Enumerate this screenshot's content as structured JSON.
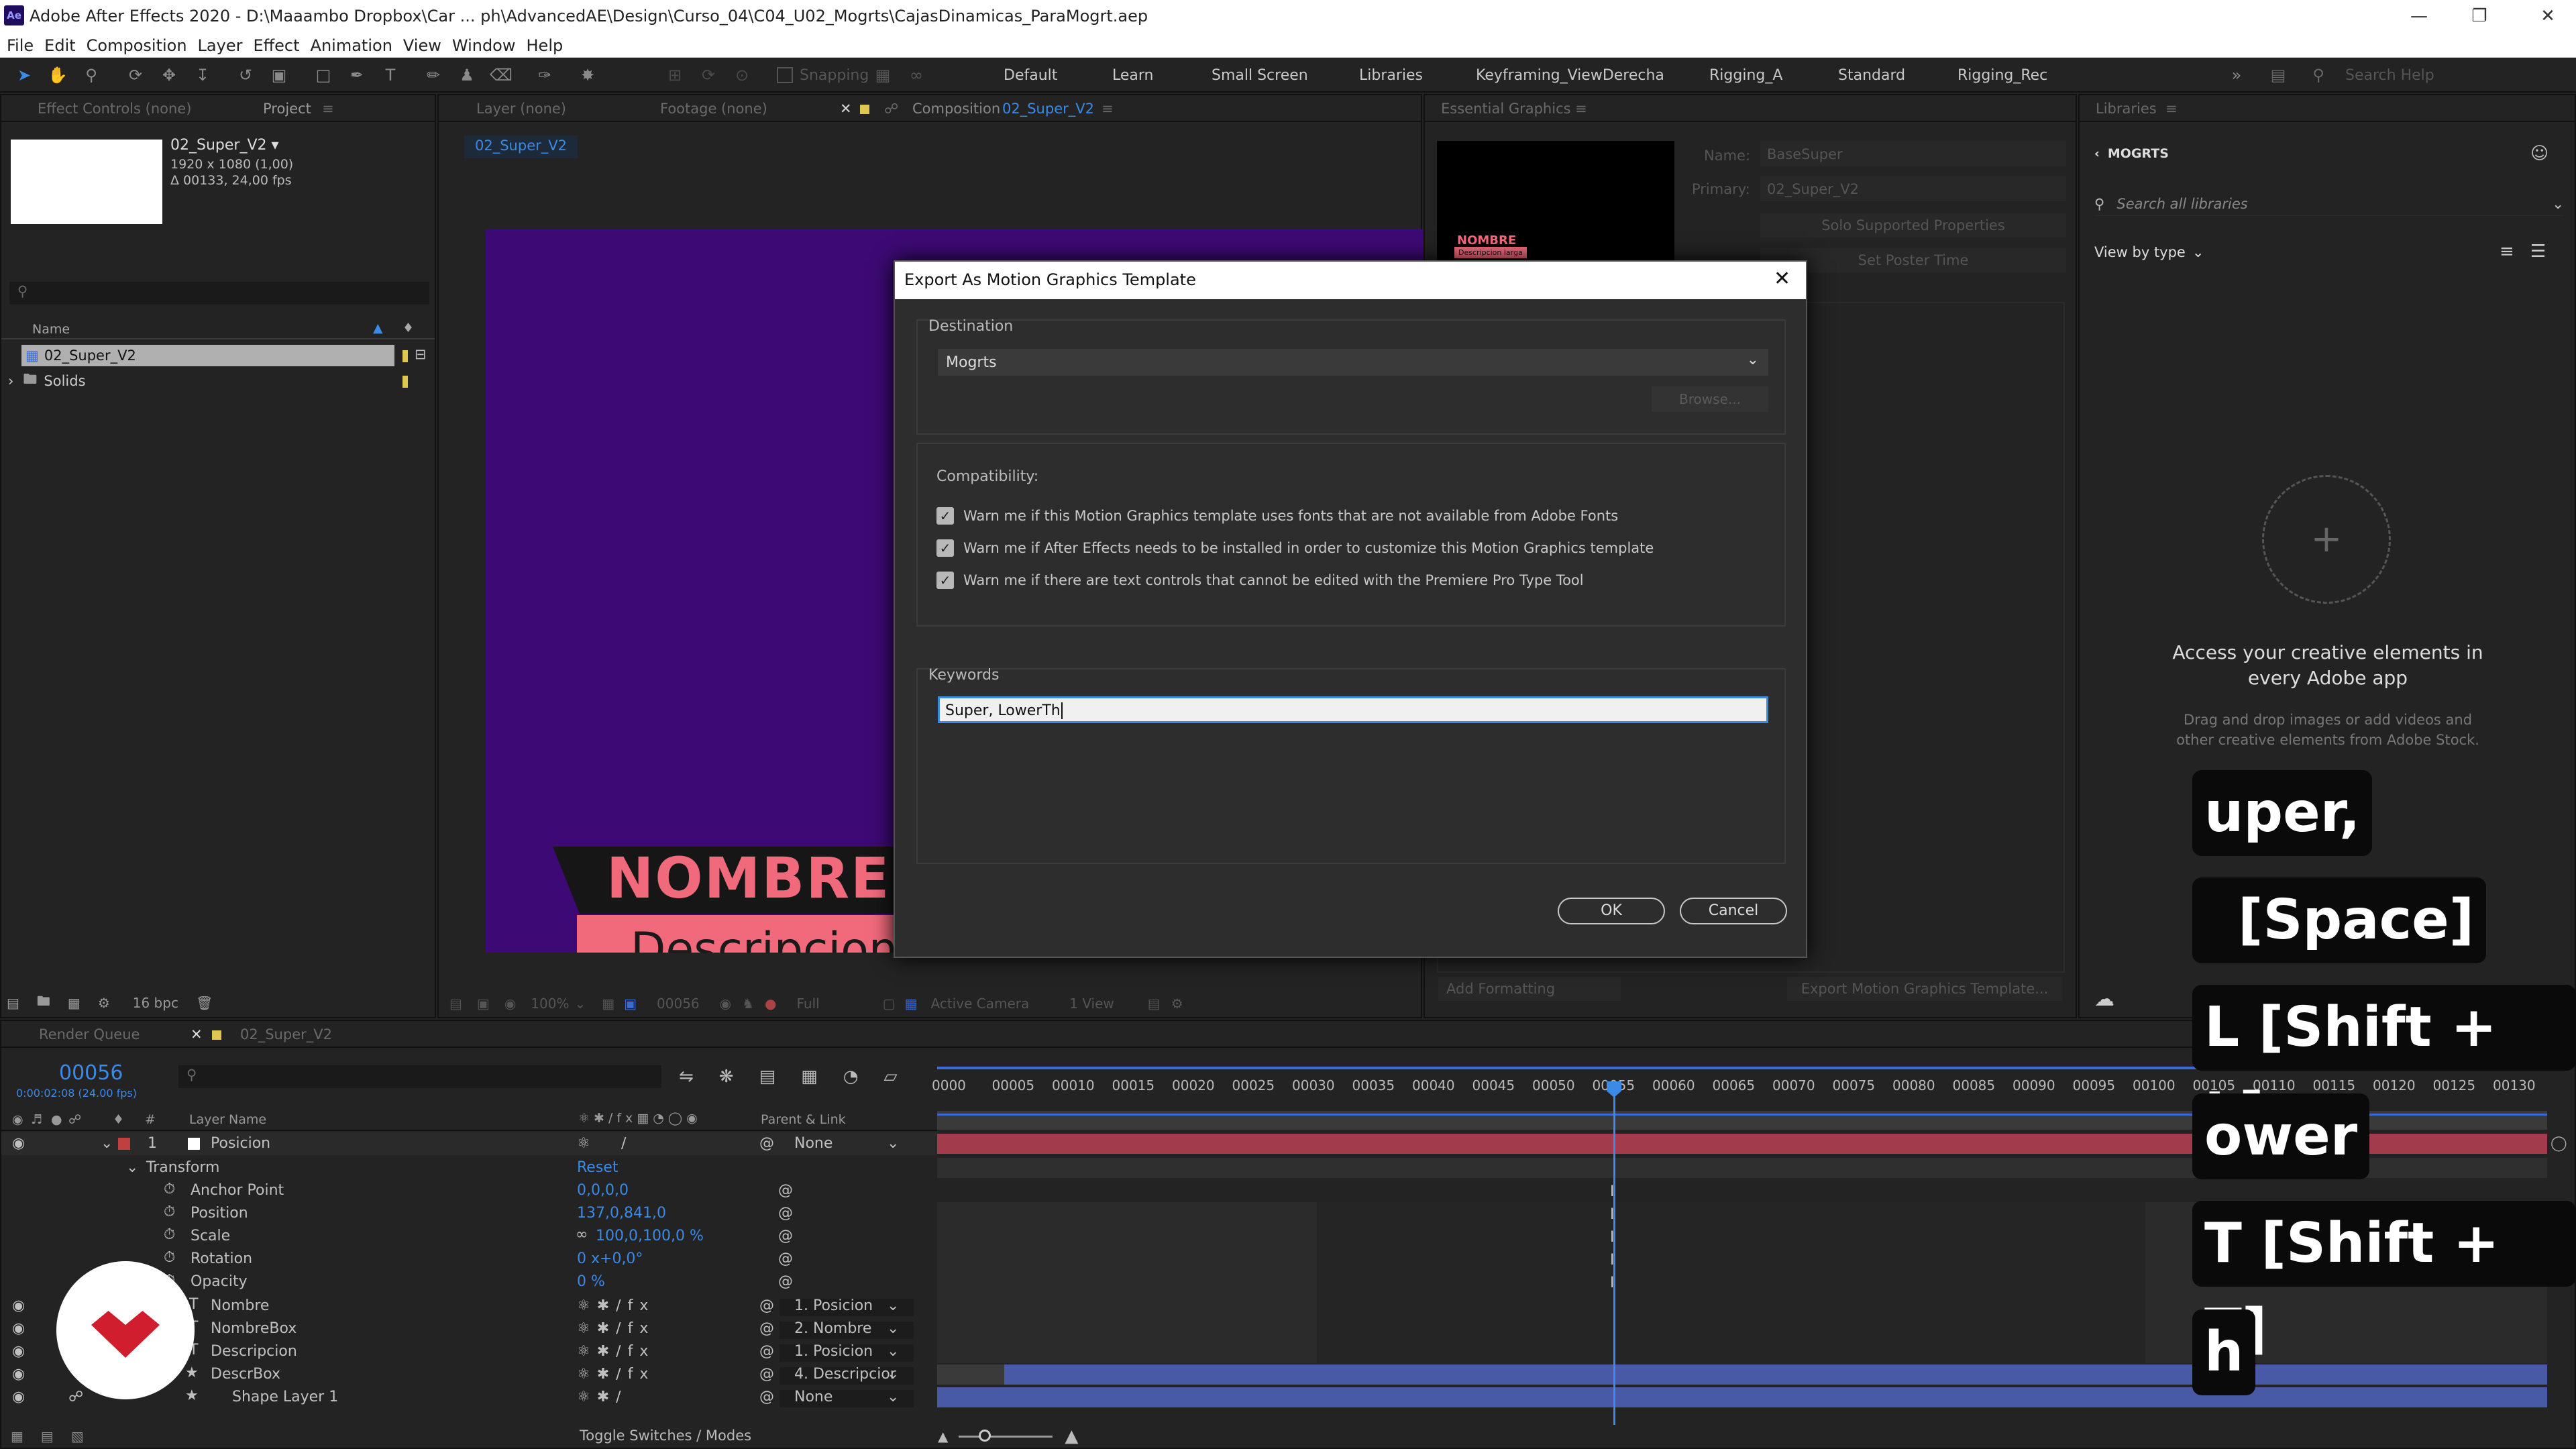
{
  "app": {
    "logo": "Ae",
    "title": "Adobe After Effects 2020 - D:\\Maaambo Dropbox\\Car ... ph\\AdvancedAE\\Design\\Curso_04\\C04_U02_Mogrts\\CajasDinamicas_ParaMogrt.aep"
  },
  "menu": [
    "File",
    "Edit",
    "Composition",
    "Layer",
    "Effect",
    "Animation",
    "View",
    "Window",
    "Help"
  ],
  "toolbar": {
    "snapping": "Snapping",
    "workspaces": [
      "Default",
      "Learn",
      "Small Screen",
      "Libraries",
      "Keyframing_ViewDerecha",
      "Rigging_A",
      "Standard",
      "Rigging_Rec"
    ],
    "search_help": "Search Help"
  },
  "project": {
    "tab_effect_controls": "Effect Controls (none)",
    "tab_project": "Project",
    "comp_name": "02_Super_V2 ▾",
    "comp_res": "1920 x 1080 (1,00)",
    "comp_dur": "Δ 00133, 24,00 fps",
    "col_name": "Name",
    "items": [
      {
        "name": "02_Super_V2",
        "type": "comp"
      },
      {
        "name": "Solids",
        "type": "folder"
      }
    ],
    "bpc": "16 bpc"
  },
  "viewer": {
    "tab_layer": "Layer (none)",
    "tab_footage": "Footage (none)",
    "tab_comp_prefix": "Composition",
    "tab_comp_name": "02_Super_V2",
    "breadcrumb": "02_Super_V2",
    "nombre": "NOMBRE",
    "descripcion": "Descripcion",
    "zoom": "100%",
    "timecode": "00056",
    "resolution": "Full",
    "camera": "Active Camera",
    "views": "1 View"
  },
  "essential_graphics": {
    "tab": "Essential Graphics",
    "name_label": "Name:",
    "name_value": "BaseSuper",
    "primary_label": "Primary:",
    "primary_value": "02_Super_V2",
    "solo_btn": "Solo Supported Properties",
    "poster_btn": "Set Poster Time",
    "thumb_nombre": "NOMBRE",
    "thumb_desc": "Descripcion larga",
    "add_formatting": "Add Formatting",
    "export_btn": "Export Motion Graphics Template..."
  },
  "libraries": {
    "tab": "Libraries",
    "back_label": "MOGRTS",
    "search_placeholder": "Search all libraries",
    "view_by": "View by type",
    "headline": "Access your creative elements in every Adobe app",
    "body": "Drag and drop images or add videos and other creative elements from Adobe Stock."
  },
  "dialog": {
    "title": "Export As Motion Graphics Template",
    "destination_label": "Destination",
    "destination_value": "Mogrts",
    "browse": "Browse...",
    "compat_label": "Compatibility:",
    "checks": [
      "Warn me if this Motion Graphics template uses fonts that are not available from Adobe Fonts",
      "Warn me if After Effects needs to be installed in order to customize this Motion Graphics template",
      "Warn me if there are text controls that cannot be edited with the Premiere Pro Type Tool"
    ],
    "keywords_label": "Keywords",
    "keywords_value": "Super, LowerTh",
    "ok": "OK",
    "cancel": "Cancel"
  },
  "timeline": {
    "tab_render": "Render Queue",
    "tab_comp": "02_Super_V2",
    "timecode": "00056",
    "timecode_sub": "0:00:02:08 (24.00 fps)",
    "col_layer_name": "Layer Name",
    "col_parent": "Parent & Link",
    "ruler": [
      "0000",
      "00005",
      "00010",
      "00015",
      "00020",
      "00025",
      "00030",
      "00035",
      "00040",
      "00045",
      "00050",
      "00055",
      "00060",
      "00065",
      "00070",
      "00075",
      "00080",
      "00085",
      "00090",
      "00095",
      "00100",
      "00105",
      "00110",
      "00115",
      "00120",
      "00125",
      "00130"
    ],
    "layer1": {
      "num": "1",
      "name": "Posicion",
      "parent": "None"
    },
    "transform": "Transform",
    "reset": "Reset",
    "props": [
      {
        "name": "Anchor Point",
        "value": "0,0,0,0"
      },
      {
        "name": "Position",
        "value": "137,0,841,0"
      },
      {
        "name": "Scale",
        "value": "100,0,100,0 %"
      },
      {
        "name": "Rotation",
        "value": "0 x+0,0°"
      },
      {
        "name": "Opacity",
        "value": "0 %"
      }
    ],
    "layers": [
      {
        "name": "Nombre",
        "parent": "1. Posicion",
        "color": "red"
      },
      {
        "name": "NombreBox",
        "parent": "2. Nombre",
        "color": "blue"
      },
      {
        "name": "Descripcion",
        "parent": "1. Posicion",
        "color": "red"
      },
      {
        "name": "DescrBox",
        "parent": "4. Descripcior",
        "color": "blue"
      },
      {
        "name": "Shape Layer 1",
        "parent": "None",
        "color": "blue"
      }
    ],
    "toggle": "Toggle Switches / Modes"
  },
  "keystrokes": [
    "uper,",
    "[Space]",
    "L [Shift + L]",
    "ower",
    "T [Shift + T]",
    "h"
  ],
  "colors": {
    "accent": "#3a8ae6",
    "comp_bg": "#3d0a75",
    "pink": "#f06a7c",
    "layer_red": "#a23c4c",
    "layer_blue": "#4859a6"
  }
}
